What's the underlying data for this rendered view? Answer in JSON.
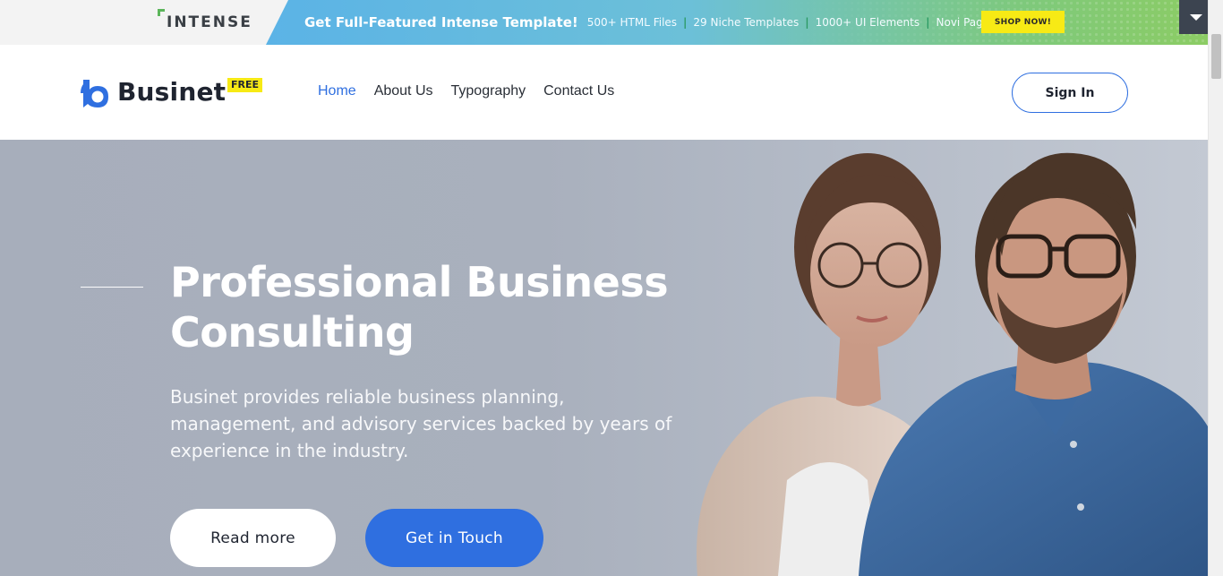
{
  "promo": {
    "logo_text": "INTENSE",
    "headline": "Get Full-Featured Intense Template!",
    "features": [
      "500+ HTML Files",
      "29 Niche Templates",
      "1000+ UI Elements",
      "Novi Page Builder"
    ],
    "shop_label": "SHOP NOW!",
    "collapse_icon": "chevron-down-icon"
  },
  "header": {
    "brand": "Businet",
    "badge": "FREE",
    "nav": [
      {
        "label": "Home",
        "active": true
      },
      {
        "label": "About Us",
        "active": false
      },
      {
        "label": "Typography",
        "active": false
      },
      {
        "label": "Contact Us",
        "active": false
      }
    ],
    "signin_label": "Sign In"
  },
  "hero": {
    "title_line1": "Professional Business",
    "title_line2": "Consulting",
    "description_line1": "Businet provides reliable business planning,",
    "description_line2": "management, and advisory services backed by years of",
    "description_line3": "experience in the industry.",
    "read_more_label": "Read more",
    "get_in_touch_label": "Get in Touch"
  },
  "colors": {
    "accent": "#2f6fe0",
    "badge_yellow": "#f7ea15",
    "hero_bg": "#a9b0bd"
  }
}
